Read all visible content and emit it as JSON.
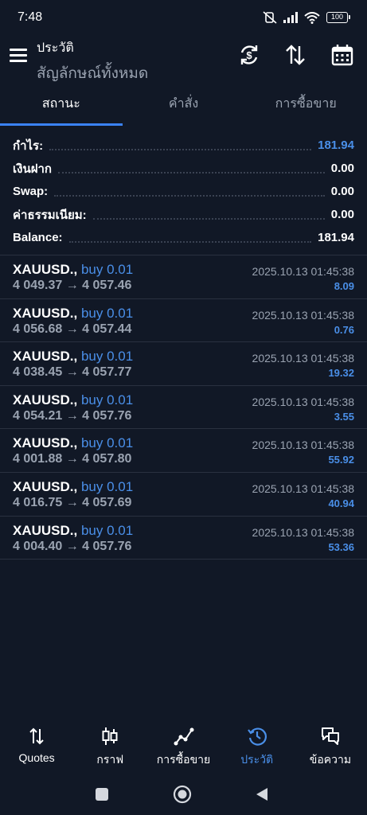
{
  "status_bar": {
    "time": "7:48",
    "battery": "100"
  },
  "header": {
    "title": "ประวัติ",
    "subtitle": "สัญลักษณ์ทั้งหมด"
  },
  "tabs": [
    {
      "label": "สถานะ",
      "active": true
    },
    {
      "label": "คำสั่ง",
      "active": false
    },
    {
      "label": "การซื้อขาย",
      "active": false
    }
  ],
  "summary": {
    "profit": {
      "label": "กำไร:",
      "value": "181.94"
    },
    "deposit": {
      "label": "เงินฝาก",
      "value": "0.00"
    },
    "swap": {
      "label": "Swap:",
      "value": "0.00"
    },
    "commission": {
      "label": "ค่าธรรมเนียม:",
      "value": "0.00"
    },
    "balance": {
      "label": "Balance:",
      "value": "181.94"
    }
  },
  "deals": [
    {
      "symbol": "XAUUSD.,",
      "side": "buy 0.01",
      "prices": "4 049.37 → 4 057.46",
      "time": "2025.10.13 01:45:38",
      "profit": "8.09"
    },
    {
      "symbol": "XAUUSD.,",
      "side": "buy 0.01",
      "prices": "4 056.68 → 4 057.44",
      "time": "2025.10.13 01:45:38",
      "profit": "0.76"
    },
    {
      "symbol": "XAUUSD.,",
      "side": "buy 0.01",
      "prices": "4 038.45 → 4 057.77",
      "time": "2025.10.13 01:45:38",
      "profit": "19.32"
    },
    {
      "symbol": "XAUUSD.,",
      "side": "buy 0.01",
      "prices": "4 054.21 → 4 057.76",
      "time": "2025.10.13 01:45:38",
      "profit": "3.55"
    },
    {
      "symbol": "XAUUSD.,",
      "side": "buy 0.01",
      "prices": "4 001.88 → 4 057.80",
      "time": "2025.10.13 01:45:38",
      "profit": "55.92"
    },
    {
      "symbol": "XAUUSD.,",
      "side": "buy 0.01",
      "prices": "4 016.75 → 4 057.69",
      "time": "2025.10.13 01:45:38",
      "profit": "40.94"
    },
    {
      "symbol": "XAUUSD.,",
      "side": "buy 0.01",
      "prices": "4 004.40 → 4 057.76",
      "time": "2025.10.13 01:45:38",
      "profit": "53.36"
    }
  ],
  "bottom_nav": [
    {
      "label": "Quotes",
      "icon": "sort-arrows-icon",
      "active": false
    },
    {
      "label": "กราฟ",
      "icon": "candlestick-icon",
      "active": false
    },
    {
      "label": "การซื้อขาย",
      "icon": "trade-line-icon",
      "active": false
    },
    {
      "label": "ประวัติ",
      "icon": "history-clock-icon",
      "active": true
    },
    {
      "label": "ข้อความ",
      "icon": "chat-bubbles-icon",
      "active": false
    }
  ],
  "colors": {
    "background": "#111826",
    "accent": "#4a8fe8",
    "tab_underline": "#3b82f6",
    "muted_text": "#9aa3b1",
    "divider": "#2a3140"
  }
}
